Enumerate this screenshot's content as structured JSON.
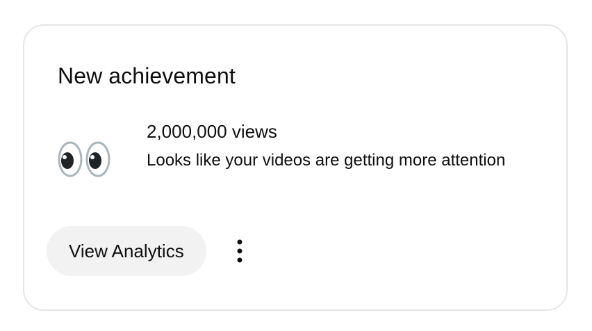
{
  "card": {
    "title": "New achievement",
    "icon": "eyes-emoji",
    "headline": "2,000,000 views",
    "description": "Looks like your videos are getting more attention",
    "primary_action_label": "View Analytics",
    "more_icon": "vertical-ellipsis-icon"
  },
  "colors": {
    "text": "#0f0f0f",
    "card_border": "#e5e5e5",
    "button_background": "#f2f2f2"
  }
}
